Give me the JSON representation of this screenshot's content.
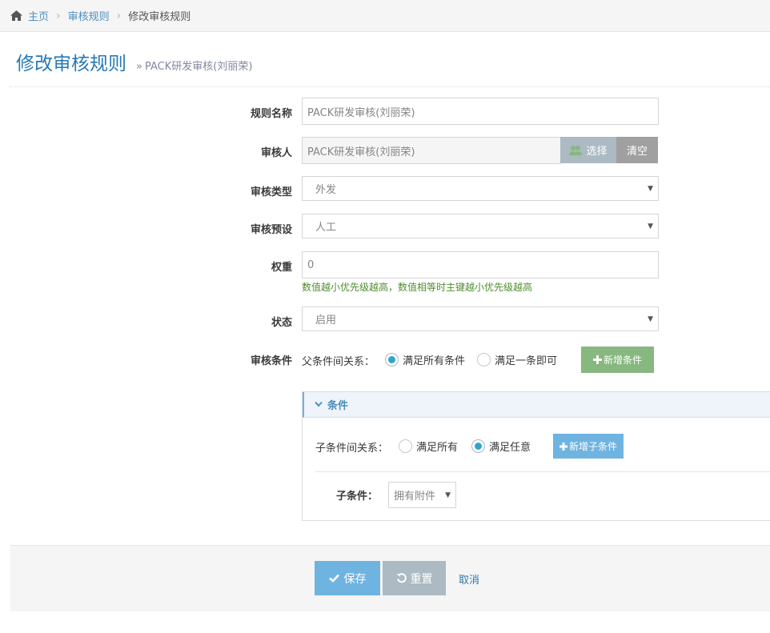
{
  "breadcrumb": {
    "home": "主页",
    "rules": "审核规则",
    "current": "修改审核规则",
    "separator": "›"
  },
  "header": {
    "title": "修改审核规则",
    "subtitle_marker": "»",
    "subtitle": "PACK研发审核(刘丽荣)"
  },
  "form": {
    "rule_name": {
      "label": "规则名称",
      "value": "PACK研发审核(刘丽荣)"
    },
    "reviewer": {
      "label": "审核人",
      "value": "PACK研发审核(刘丽荣)",
      "choose_label": "选择",
      "clear_label": "清空"
    },
    "review_type": {
      "label": "审核类型",
      "value": "外发"
    },
    "review_preset": {
      "label": "审核预设",
      "value": "人工"
    },
    "weight": {
      "label": "权重",
      "value": "0",
      "help": "数值越小优先级越高，数值相等时主键越小优先级越高"
    },
    "status": {
      "label": "状态",
      "value": "启用"
    },
    "conditions": {
      "label": "审核条件",
      "parent_relation_label": "父条件间关系：",
      "option_all": "满足所有条件",
      "option_any": "满足一条即可",
      "selected": "all",
      "add_label": "新增条件"
    }
  },
  "condition_panel": {
    "title": "条件",
    "child_relation_label": "子条件间关系：",
    "option_all": "满足所有",
    "option_any": "满足任意",
    "selected": "any",
    "add_child_label": "新增子条件",
    "child_label": "子条件：",
    "child_value": "拥有附件"
  },
  "actions": {
    "save": "保存",
    "reset": "重置",
    "cancel": "取消"
  },
  "icons": {
    "home": "home-icon",
    "users": "users-icon",
    "plus": "plus-icon",
    "chevron": "chevron-down-icon",
    "check": "check-icon",
    "undo": "undo-icon",
    "caret": "caret-down-icon"
  },
  "colors": {
    "link": "#4c8fbd",
    "title": "#2679b5",
    "primary": "#6fb3e0",
    "success": "#87b87f",
    "gray": "#abbac3",
    "help": "#4f8e2f",
    "radio_checked": "#32a3ce"
  }
}
